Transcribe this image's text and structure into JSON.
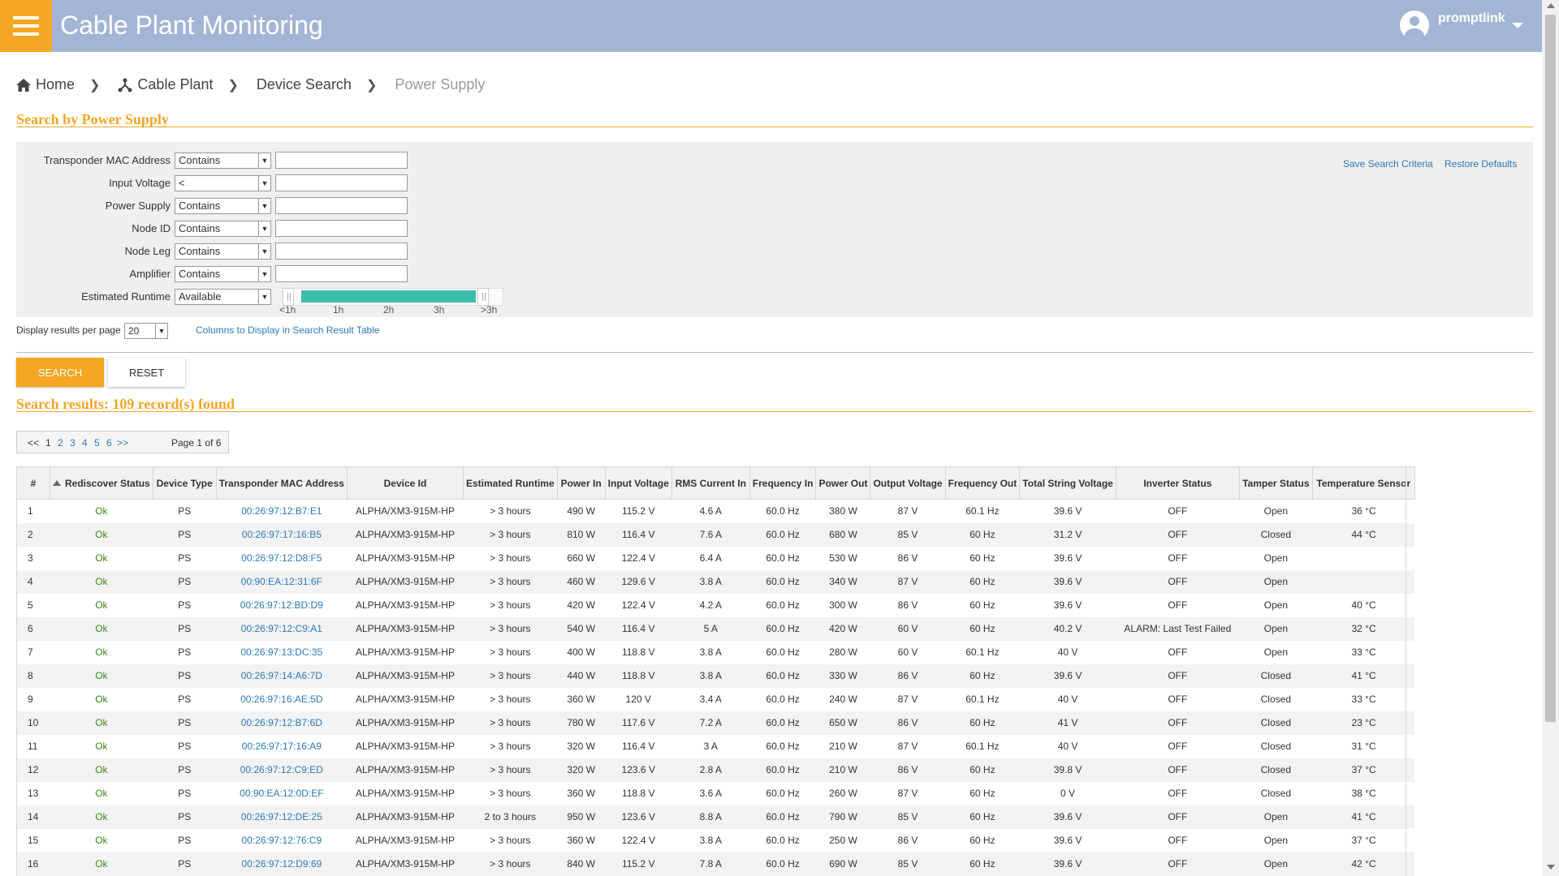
{
  "header": {
    "title": "Cable Plant Monitoring",
    "user": "promptlink"
  },
  "breadcrumb": {
    "home": "Home",
    "cable_plant": "Cable Plant",
    "device_search": "Device Search",
    "current": "Power Supply"
  },
  "search": {
    "title": "Search by Power Supply",
    "fields": [
      {
        "label": "Transponder MAC Address",
        "operator": "Contains",
        "value": ""
      },
      {
        "label": "Input Voltage",
        "operator": "<",
        "value": ""
      },
      {
        "label": "Power Supply",
        "operator": "Contains",
        "value": ""
      },
      {
        "label": "Node ID",
        "operator": "Contains",
        "value": ""
      },
      {
        "label": "Node Leg",
        "operator": "Contains",
        "value": ""
      },
      {
        "label": "Amplifier",
        "operator": "Contains",
        "value": ""
      },
      {
        "label": "Estimated Runtime",
        "operator": "Available"
      }
    ],
    "slider_ticks": [
      "<1h",
      "1h",
      "2h",
      "3h",
      ">3h"
    ],
    "save_link": "Save Search Criteria",
    "restore_link": "Restore Defaults",
    "per_page_label": "Display results per page",
    "per_page_value": "20",
    "columns_link": "Columns to Display in Search Result Table",
    "search_button": "SEARCH",
    "reset_button": "RESET"
  },
  "results": {
    "title": "Search results: 109 record(s) found",
    "pagination": {
      "first": "<<",
      "pages": [
        "1",
        "2",
        "3",
        "4",
        "5",
        "6"
      ],
      "last": ">>",
      "info": "Page 1 of 6"
    },
    "columns": [
      "#",
      "Rediscover Status",
      "Device Type",
      "Transponder MAC Address",
      "Device Id",
      "Estimated Runtime",
      "Power In",
      "Input Voltage",
      "RMS Current In",
      "Frequency In",
      "Power Out",
      "Output Voltage",
      "Frequency Out",
      "Total String Voltage",
      "Inverter Status",
      "Tamper Status",
      "Temperature Sensor"
    ],
    "rows": [
      [
        "1",
        "Ok",
        "PS",
        "00:26:97:12:B7:E1",
        "ALPHA/XM3-915M-HP",
        "> 3 hours",
        "490 W",
        "115.2 V",
        "4.6 A",
        "60.0 Hz",
        "380 W",
        "87 V",
        "60.1 Hz",
        "39.6 V",
        "OFF",
        "Open",
        "36 °C"
      ],
      [
        "2",
        "Ok",
        "PS",
        "00:26:97:17:16:B5",
        "ALPHA/XM3-915M-HP",
        "> 3 hours",
        "810 W",
        "116.4 V",
        "7.6 A",
        "60.0 Hz",
        "680 W",
        "85 V",
        "60 Hz",
        "31.2 V",
        "OFF",
        "Closed",
        "44 °C"
      ],
      [
        "3",
        "Ok",
        "PS",
        "00:26:97:12:D8:F5",
        "ALPHA/XM3-915M-HP",
        "> 3 hours",
        "660 W",
        "122.4 V",
        "6.4 A",
        "60.0 Hz",
        "530 W",
        "86 V",
        "60 Hz",
        "39.6 V",
        "OFF",
        "Open",
        ""
      ],
      [
        "4",
        "Ok",
        "PS",
        "00:90:EA:12:31:6F",
        "ALPHA/XM3-915M-HP",
        "> 3 hours",
        "460 W",
        "129.6 V",
        "3.8 A",
        "60.0 Hz",
        "340 W",
        "87 V",
        "60 Hz",
        "39.6 V",
        "OFF",
        "Open",
        ""
      ],
      [
        "5",
        "Ok",
        "PS",
        "00:26:97:12:BD:D9",
        "ALPHA/XM3-915M-HP",
        "> 3 hours",
        "420 W",
        "122.4 V",
        "4.2 A",
        "60.0 Hz",
        "300 W",
        "86 V",
        "60 Hz",
        "39.6 V",
        "OFF",
        "Open",
        "40 °C"
      ],
      [
        "6",
        "Ok",
        "PS",
        "00:26:97:12:C9:A1",
        "ALPHA/XM3-915M-HP",
        "> 3 hours",
        "540 W",
        "116.4 V",
        "5 A",
        "60.0 Hz",
        "420 W",
        "60 V",
        "60 Hz",
        "40.2 V",
        "ALARM: Last Test Failed",
        "Open",
        "32 °C"
      ],
      [
        "7",
        "Ok",
        "PS",
        "00:26:97:13:DC:35",
        "ALPHA/XM3-915M-HP",
        "> 3 hours",
        "400 W",
        "118.8 V",
        "3.8 A",
        "60.0 Hz",
        "280 W",
        "60 V",
        "60.1 Hz",
        "40 V",
        "OFF",
        "Open",
        "33 °C"
      ],
      [
        "8",
        "Ok",
        "PS",
        "00:26:97:14:A6:7D",
        "ALPHA/XM3-915M-HP",
        "> 3 hours",
        "440 W",
        "118.8 V",
        "3.8 A",
        "60.0 Hz",
        "330 W",
        "86 V",
        "60 Hz",
        "39.6 V",
        "OFF",
        "Closed",
        "41 °C"
      ],
      [
        "9",
        "Ok",
        "PS",
        "00:26:97:16:AE:5D",
        "ALPHA/XM3-915M-HP",
        "> 3 hours",
        "360 W",
        "120 V",
        "3.4 A",
        "60.0 Hz",
        "240 W",
        "87 V",
        "60.1 Hz",
        "40 V",
        "OFF",
        "Closed",
        "33 °C"
      ],
      [
        "10",
        "Ok",
        "PS",
        "00:26:97:12:B7:6D",
        "ALPHA/XM3-915M-HP",
        "> 3 hours",
        "780 W",
        "117.6 V",
        "7.2 A",
        "60.0 Hz",
        "650 W",
        "86 V",
        "60 Hz",
        "41 V",
        "OFF",
        "Closed",
        "23 °C"
      ],
      [
        "11",
        "Ok",
        "PS",
        "00:26:97:17:16:A9",
        "ALPHA/XM3-915M-HP",
        "> 3 hours",
        "320 W",
        "116.4 V",
        "3 A",
        "60.0 Hz",
        "210 W",
        "87 V",
        "60.1 Hz",
        "40 V",
        "OFF",
        "Closed",
        "31 °C"
      ],
      [
        "12",
        "Ok",
        "PS",
        "00:26:97:12:C9:ED",
        "ALPHA/XM3-915M-HP",
        "> 3 hours",
        "320 W",
        "123.6 V",
        "2.8 A",
        "60.0 Hz",
        "210 W",
        "86 V",
        "60 Hz",
        "39.8 V",
        "OFF",
        "Closed",
        "37 °C"
      ],
      [
        "13",
        "Ok",
        "PS",
        "00:90:EA:12:0D:EF",
        "ALPHA/XM3-915M-HP",
        "> 3 hours",
        "360 W",
        "118.8 V",
        "3.6 A",
        "60.0 Hz",
        "260 W",
        "87 V",
        "60 Hz",
        "0 V",
        "OFF",
        "Closed",
        "38 °C"
      ],
      [
        "14",
        "Ok",
        "PS",
        "00:26:97:12:DE:25",
        "ALPHA/XM3-915M-HP",
        "2 to 3 hours",
        "950 W",
        "123.6 V",
        "8.8 A",
        "60.0 Hz",
        "790 W",
        "85 V",
        "60 Hz",
        "39.6 V",
        "OFF",
        "Open",
        "41 °C"
      ],
      [
        "15",
        "Ok",
        "PS",
        "00:26:97:12:76:C9",
        "ALPHA/XM3-915M-HP",
        "> 3 hours",
        "360 W",
        "122.4 V",
        "3.8 A",
        "60.0 Hz",
        "250 W",
        "86 V",
        "60 Hz",
        "39.6 V",
        "OFF",
        "Open",
        "37 °C"
      ],
      [
        "16",
        "Ok",
        "PS",
        "00:26:97:12:D9:69",
        "ALPHA/XM3-915M-HP",
        "> 3 hours",
        "840 W",
        "115.2 V",
        "7.8 A",
        "60.0 Hz",
        "690 W",
        "85 V",
        "60 Hz",
        "39.6 V",
        "OFF",
        "Open",
        "42 °C"
      ]
    ]
  }
}
